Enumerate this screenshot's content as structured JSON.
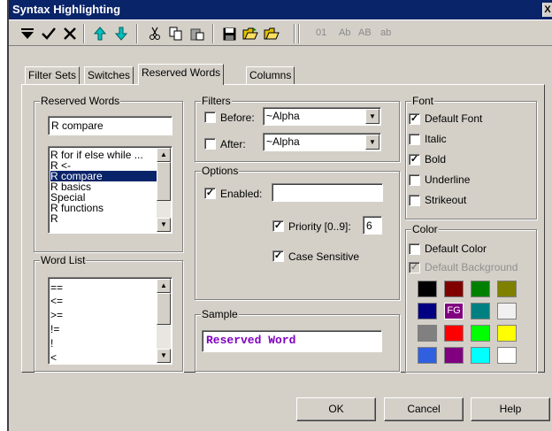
{
  "window": {
    "title": "Syntax Highlighting",
    "close_glyph": "X"
  },
  "toolbar": {
    "icons": [
      "menu-arrow-icon",
      "check-icon",
      "delete-icon",
      "move-up-icon",
      "move-down-icon",
      "cut-icon",
      "copy-icon",
      "paste-icon",
      "save-icon",
      "open-folder-icon",
      "folder-icon"
    ],
    "num_label": "01",
    "case_labels": [
      "Ab",
      "AB",
      "ab"
    ]
  },
  "tabs": [
    "Filter Sets",
    "Switches",
    "Reserved Words",
    "Columns"
  ],
  "reserved_words": {
    "label": "Reserved Words",
    "current_value": "R compare",
    "items": [
      "R for if else while ...",
      "R <-",
      "R compare",
      "R basics",
      "Special",
      "R functions",
      "R "
    ],
    "selected_index": 2
  },
  "word_list": {
    "label": "Word List",
    "items": [
      "==",
      "<=",
      ">=",
      "!=",
      "!",
      "<"
    ]
  },
  "filters": {
    "label": "Filters",
    "before_label": "Before:",
    "before_value": "~Alpha",
    "after_label": "After:",
    "after_value": "~Alpha"
  },
  "options": {
    "label": "Options",
    "enabled_label": "Enabled:",
    "enabled_checked": true,
    "enabled_value": "",
    "priority_label": "Priority [0..9]:",
    "priority_value": "6",
    "priority_checked": true,
    "case_label": "Case Sensitive",
    "case_checked": true
  },
  "sample": {
    "label": "Sample",
    "text": "Reserved Word",
    "color": "#8000c0"
  },
  "font": {
    "label": "Font",
    "options": [
      {
        "label": "Default Font",
        "checked": true
      },
      {
        "label": "Italic",
        "checked": false
      },
      {
        "label": "Bold",
        "checked": true
      },
      {
        "label": "Underline",
        "checked": false
      },
      {
        "label": "Strikeout",
        "checked": false
      }
    ]
  },
  "color": {
    "label": "Color",
    "default_color_label": "Default Color",
    "default_color_checked": false,
    "default_bg_label": "Default Background",
    "default_bg_checked": true,
    "fg_label": "FG",
    "swatches": [
      "#000000",
      "#800000",
      "#008000",
      "#808000",
      "#000080",
      "#800080",
      "#008080",
      "#f0f0f0",
      "#808080",
      "#ff0000",
      "#00ff00",
      "#ffff00",
      "#3060e0",
      "#800080",
      "#00ffff",
      "#ffffff"
    ],
    "fg_index": 5
  },
  "buttons": {
    "ok": "OK",
    "cancel": "Cancel",
    "help": "Help"
  }
}
